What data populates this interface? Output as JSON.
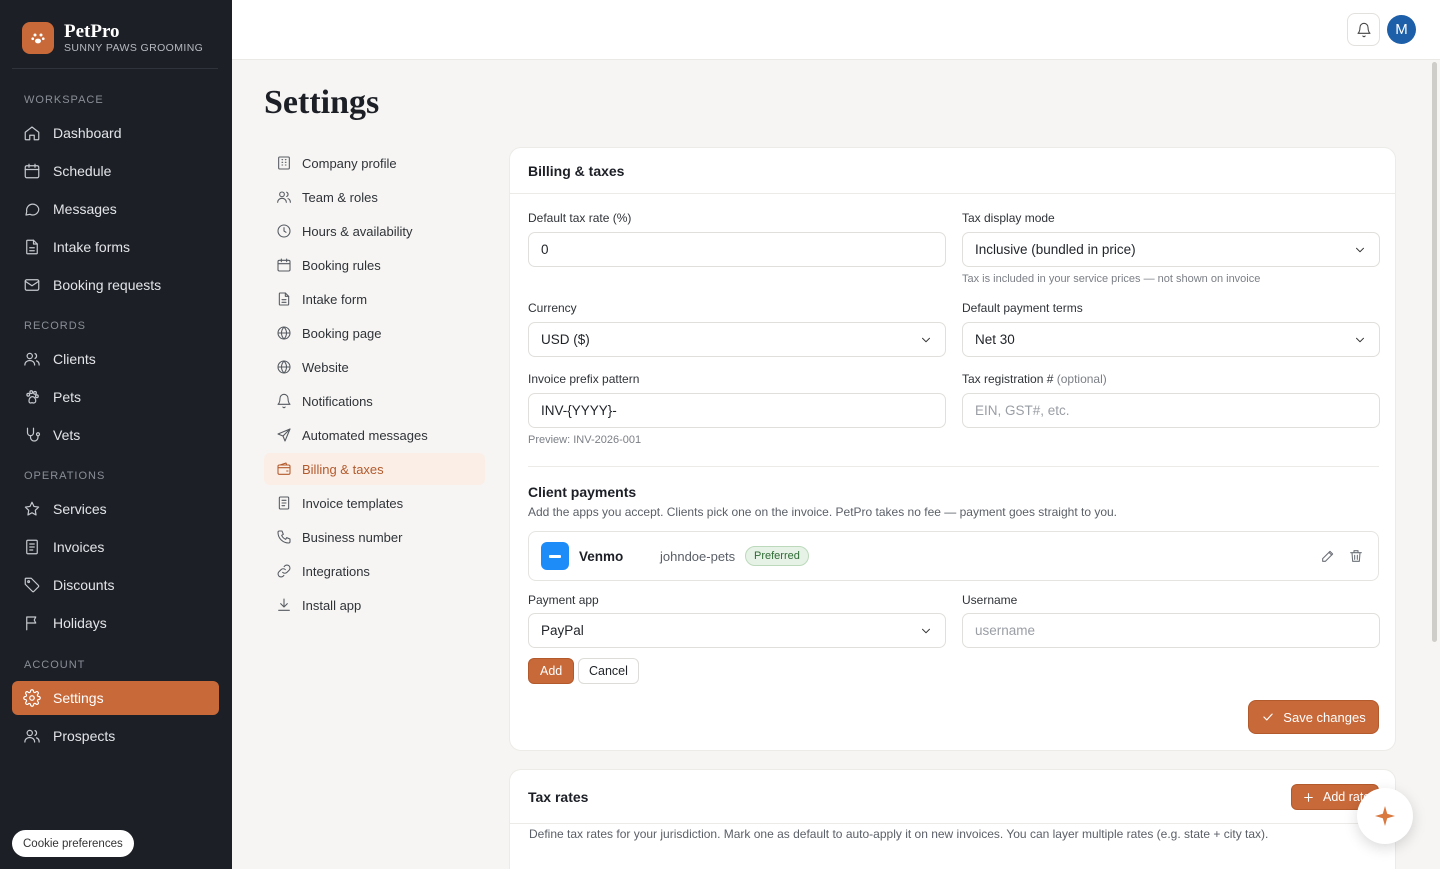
{
  "brand": {
    "name": "PetPro",
    "subtitle": "SUNNY PAWS GROOMING"
  },
  "sidebar": {
    "sections": [
      "WORKSPACE",
      "RECORDS",
      "OPERATIONS",
      "ACCOUNT"
    ],
    "items": [
      {
        "label": "Dashboard",
        "icon": "home-icon"
      },
      {
        "label": "Schedule",
        "icon": "calendar-icon"
      },
      {
        "label": "Messages",
        "icon": "chat-icon"
      },
      {
        "label": "Intake forms",
        "icon": "document-icon"
      },
      {
        "label": "Booking requests",
        "icon": "mail-icon"
      },
      {
        "label": "Clients",
        "icon": "users-icon"
      },
      {
        "label": "Pets",
        "icon": "paw-icon"
      },
      {
        "label": "Vets",
        "icon": "stethoscope-icon"
      },
      {
        "label": "Services",
        "icon": "star-icon"
      },
      {
        "label": "Invoices",
        "icon": "receipt-icon"
      },
      {
        "label": "Discounts",
        "icon": "tag-icon"
      },
      {
        "label": "Holidays",
        "icon": "flag-icon"
      },
      {
        "label": "Settings",
        "icon": "gear-icon",
        "active": true
      },
      {
        "label": "Prospects",
        "icon": "users-icon"
      }
    ],
    "cookie_label": "Cookie preferences"
  },
  "topbar": {
    "avatar_initial": "M"
  },
  "page": {
    "title": "Settings"
  },
  "subnav": [
    {
      "label": "Company profile",
      "icon": "building-icon"
    },
    {
      "label": "Team & roles",
      "icon": "users-icon"
    },
    {
      "label": "Hours & availability",
      "icon": "clock-icon"
    },
    {
      "label": "Booking rules",
      "icon": "calendar-icon"
    },
    {
      "label": "Intake form",
      "icon": "document-icon"
    },
    {
      "label": "Booking page",
      "icon": "globe-icon"
    },
    {
      "label": "Website",
      "icon": "globe-icon"
    },
    {
      "label": "Notifications",
      "icon": "bell-icon"
    },
    {
      "label": "Automated messages",
      "icon": "send-icon"
    },
    {
      "label": "Billing & taxes",
      "icon": "wallet-icon",
      "active": true
    },
    {
      "label": "Invoice templates",
      "icon": "receipt-icon"
    },
    {
      "label": "Business number",
      "icon": "phone-icon"
    },
    {
      "label": "Integrations",
      "icon": "link-icon"
    },
    {
      "label": "Install app",
      "icon": "download-icon"
    }
  ],
  "billing": {
    "title": "Billing & taxes",
    "tax_rate": {
      "label": "Default tax rate (%)",
      "value": "0"
    },
    "tax_display": {
      "label": "Tax display mode",
      "value": "Inclusive (bundled in price)",
      "hint": "Tax is included in your service prices — not shown on invoice"
    },
    "currency": {
      "label": "Currency",
      "value": "USD ($)"
    },
    "payment_terms": {
      "label": "Default payment terms",
      "value": "Net 30"
    },
    "invoice_prefix": {
      "label": "Invoice prefix pattern",
      "value": "INV-{YYYY}-",
      "preview": "Preview: INV-2026-001"
    },
    "tax_reg": {
      "label": "Tax registration #",
      "optional": "(optional)",
      "placeholder": "EIN, GST#, etc."
    },
    "client_payments": {
      "title": "Client payments",
      "description": "Add the apps you accept. Clients pick one on the invoice. PetPro takes no fee — payment goes straight to you.",
      "method": {
        "name": "Venmo",
        "username": "johndoe-pets",
        "badge": "Preferred"
      },
      "payment_app": {
        "label": "Payment app",
        "value": "PayPal"
      },
      "username": {
        "label": "Username",
        "placeholder": "username"
      },
      "add_label": "Add",
      "cancel_label": "Cancel"
    },
    "save_label": "Save changes"
  },
  "tax_rates": {
    "title": "Tax rates",
    "add_label": "Add rate",
    "description": "Define tax rates for your jurisdiction. Mark one as default to auto-apply it on new invoices. You can layer multiple rates (e.g. state + city tax)."
  }
}
